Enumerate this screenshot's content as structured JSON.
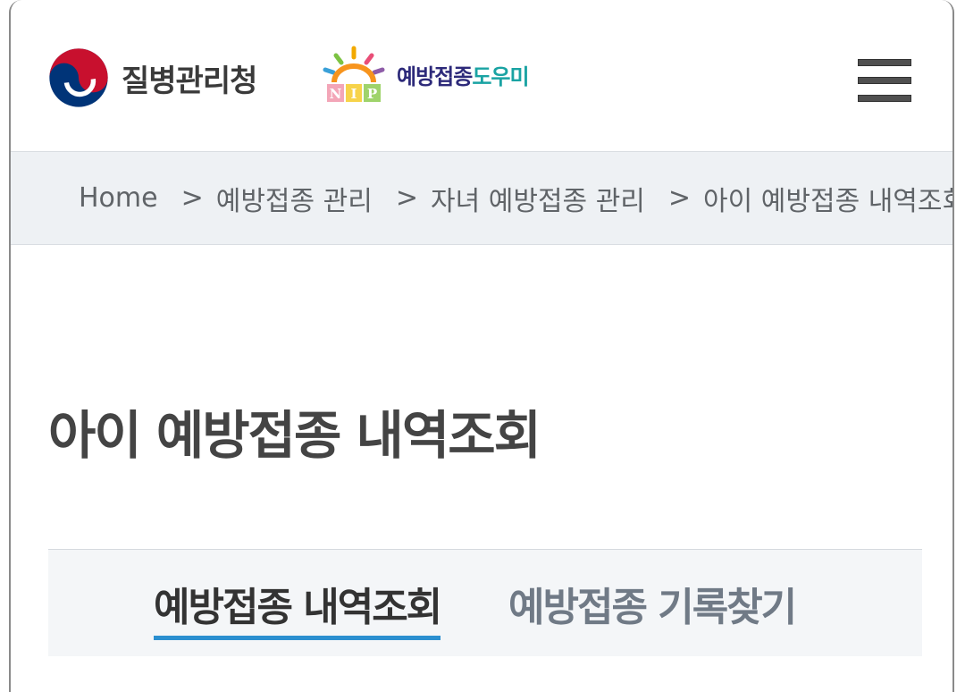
{
  "header": {
    "agency_name": "질병관리청",
    "nip_badge": "NIP",
    "nip_title_part1": "예방접종",
    "nip_title_part2": "도우미",
    "menu_icon": "hamburger-menu-icon",
    "colors": {
      "emblem_red": "#c8102e",
      "emblem_blue": "#003478",
      "nip_navy": "#2d2a7a",
      "nip_teal": "#1aa3a3"
    }
  },
  "breadcrumb": {
    "home": "Home",
    "separator": ">",
    "items": [
      "예방접종 관리",
      "자녀 예방접종 관리",
      "아이 예방접종 내역조회"
    ]
  },
  "page": {
    "title": "아이 예방접종 내역조회"
  },
  "tabs": [
    {
      "label": "예방접종 내역조회",
      "active": true
    },
    {
      "label": "예방접종 기록찾기",
      "active": false
    }
  ],
  "accent_color": "#2b8fd0"
}
